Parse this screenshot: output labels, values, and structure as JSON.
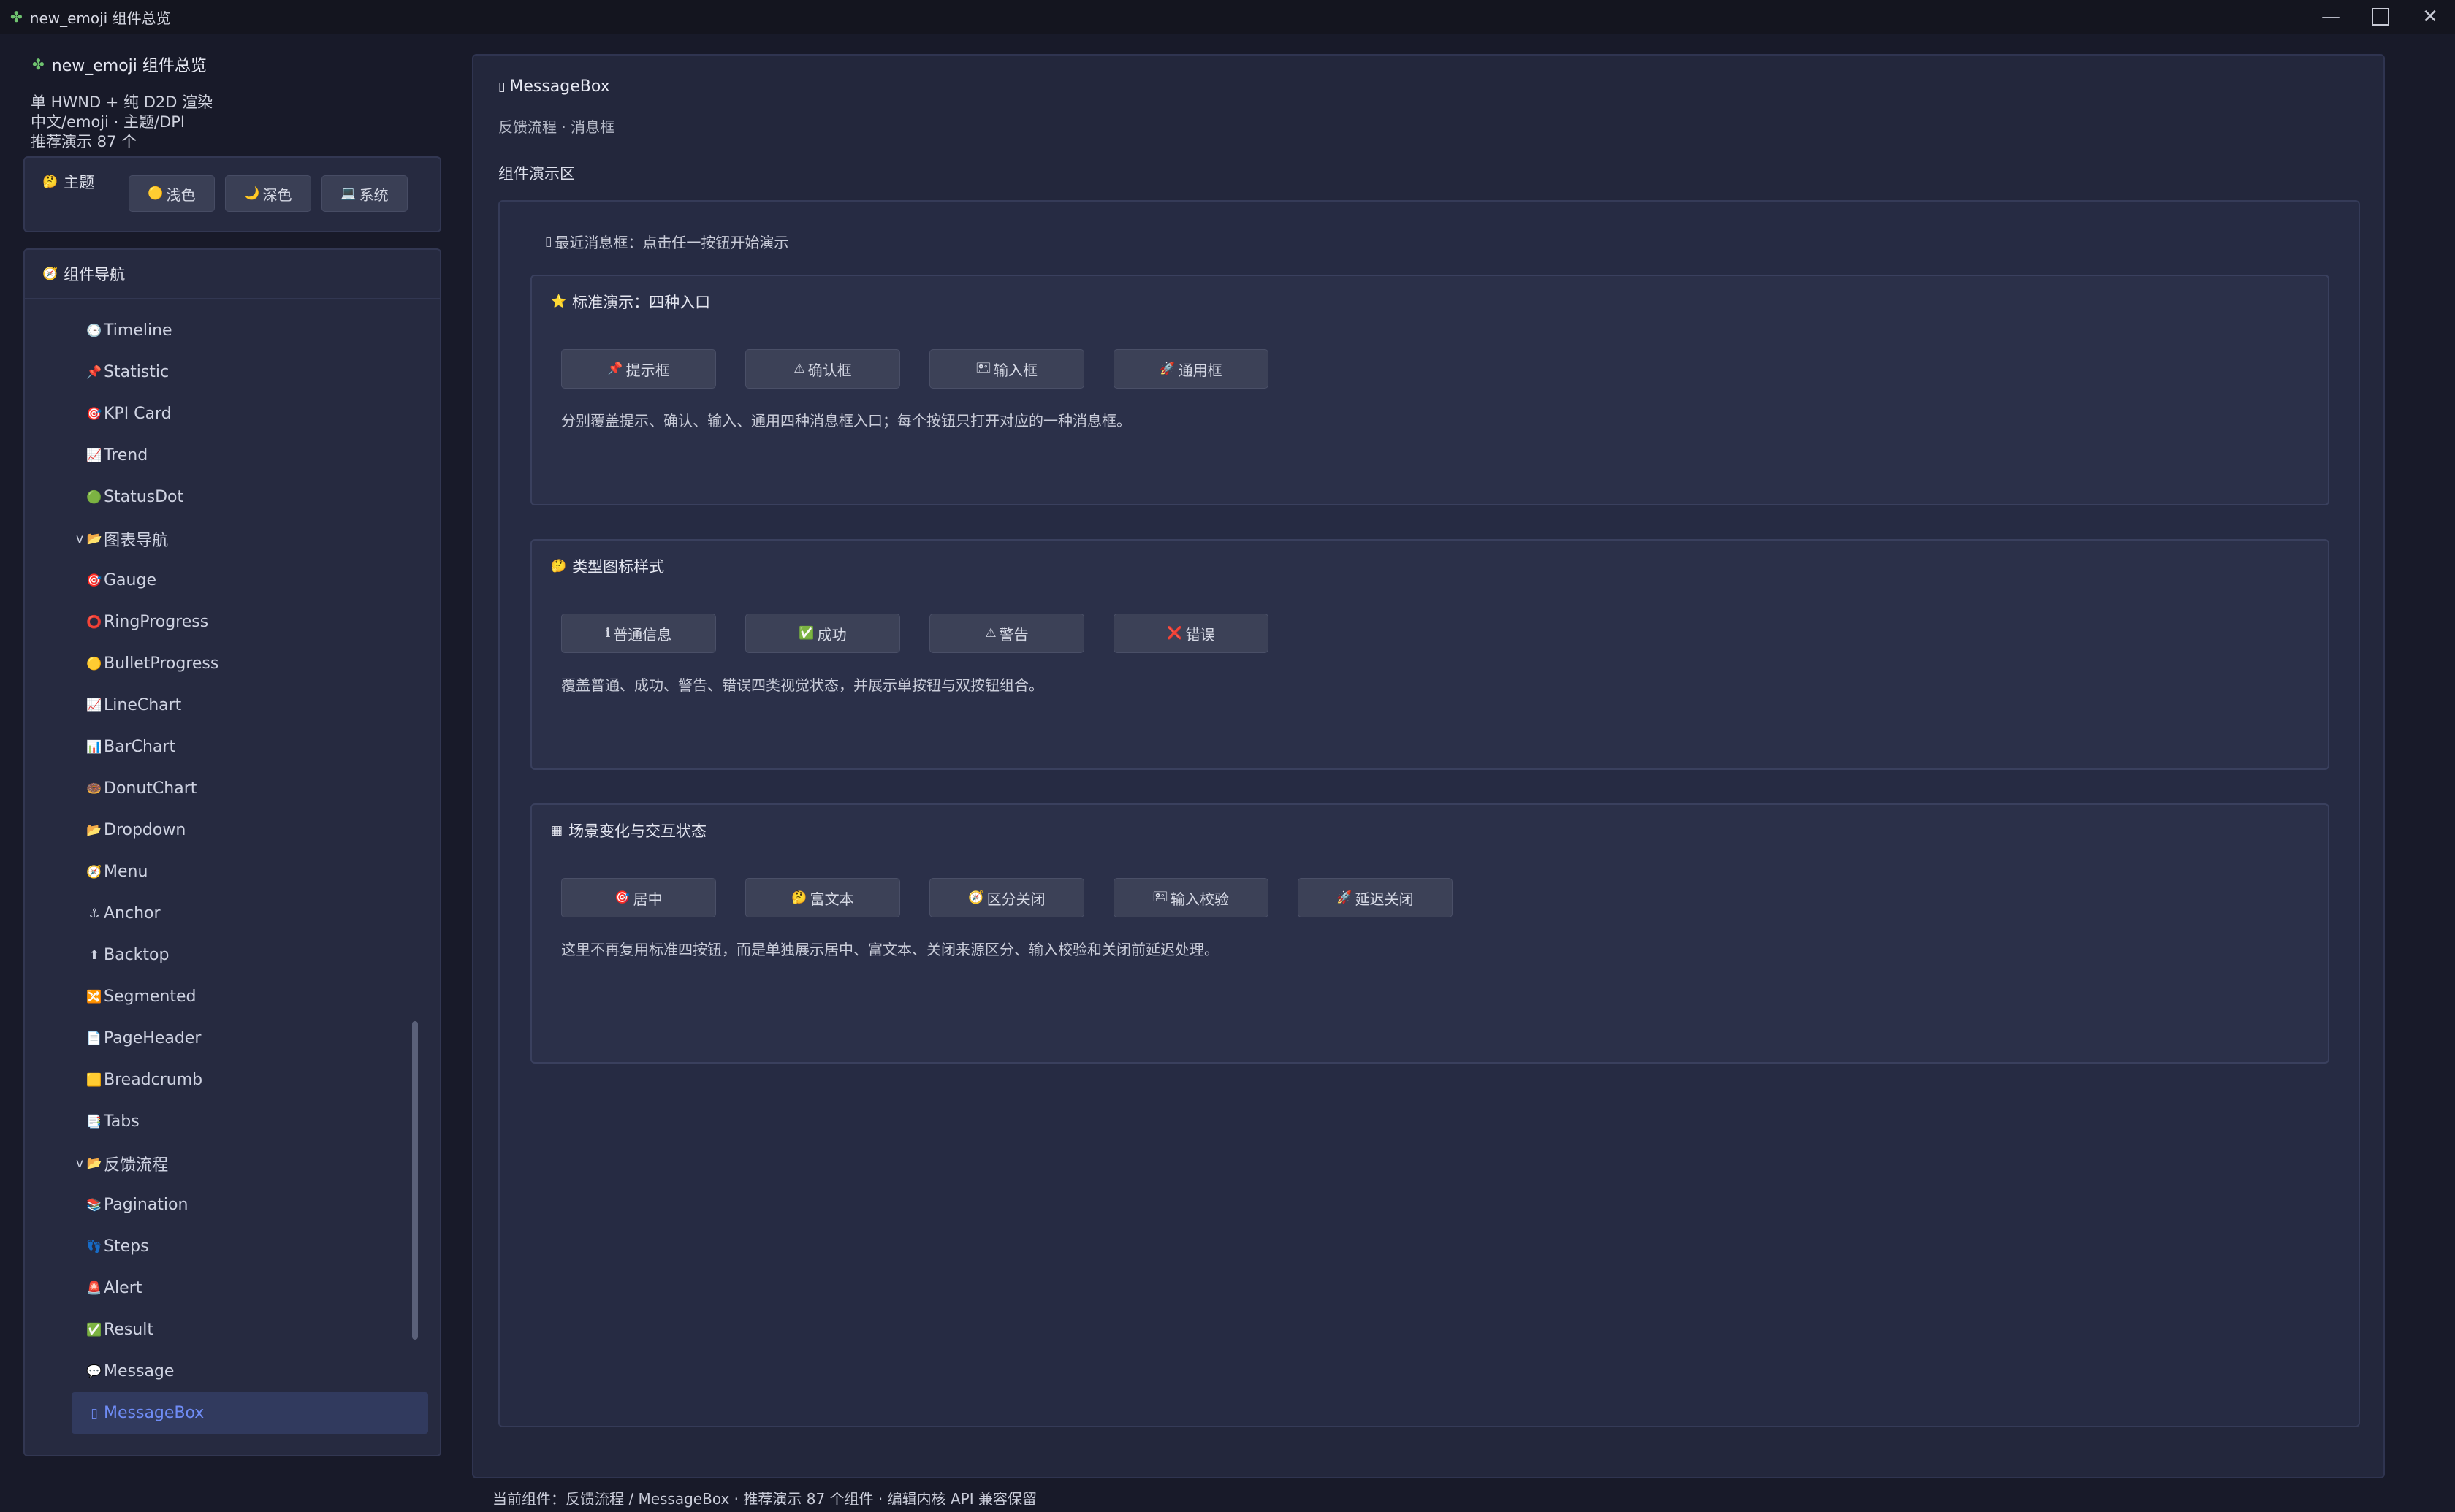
{
  "window": {
    "title": "new_emoji 组件总览",
    "icon": "✤"
  },
  "sidebar": {
    "brand_icon": "✤",
    "brand": "new_emoji 组件总览",
    "info": [
      "单 HWND + 纯 D2D 渲染",
      "中文/emoji · 主题/DPI",
      "推荐演示 87 个"
    ],
    "theme": {
      "icon": "🤔",
      "label": "主题",
      "buttons": [
        {
          "icon": "🟡",
          "label": "浅色"
        },
        {
          "icon": "🌙",
          "label": "深色"
        },
        {
          "icon": "💻",
          "label": "系统"
        }
      ]
    },
    "nav": {
      "icon": "🧭",
      "heading": "组件导航",
      "items": [
        {
          "type": "leaf",
          "icon": "🕒",
          "label": "Timeline"
        },
        {
          "type": "leaf",
          "icon": "📌",
          "label": "Statistic"
        },
        {
          "type": "leaf",
          "icon": "🎯",
          "label": "KPI Card"
        },
        {
          "type": "leaf",
          "icon": "📈",
          "label": "Trend"
        },
        {
          "type": "leaf",
          "icon": "🟢",
          "label": "StatusDot"
        },
        {
          "type": "group",
          "icon": "📂",
          "label": "图表导航",
          "chevron": "v"
        },
        {
          "type": "leaf",
          "icon": "🎯",
          "label": "Gauge"
        },
        {
          "type": "leaf",
          "icon": "⭕",
          "label": "RingProgress"
        },
        {
          "type": "leaf",
          "icon": "🟡",
          "label": "BulletProgress"
        },
        {
          "type": "leaf",
          "icon": "📈",
          "label": "LineChart"
        },
        {
          "type": "leaf",
          "icon": "📊",
          "label": "BarChart"
        },
        {
          "type": "leaf",
          "icon": "🍩",
          "label": "DonutChart"
        },
        {
          "type": "leaf",
          "icon": "📂",
          "label": "Dropdown"
        },
        {
          "type": "leaf",
          "icon": "🧭",
          "label": "Menu"
        },
        {
          "type": "leaf",
          "icon": "⚓",
          "label": "Anchor"
        },
        {
          "type": "leaf",
          "icon": "⬆",
          "label": "Backtop"
        },
        {
          "type": "leaf",
          "icon": "🔀",
          "label": "Segmented"
        },
        {
          "type": "leaf",
          "icon": "📄",
          "label": "PageHeader"
        },
        {
          "type": "leaf",
          "icon": "🟨",
          "label": "Breadcrumb"
        },
        {
          "type": "leaf",
          "icon": "📑",
          "label": "Tabs"
        },
        {
          "type": "group",
          "icon": "📂",
          "label": "反馈流程",
          "chevron": "v"
        },
        {
          "type": "leaf",
          "icon": "📚",
          "label": "Pagination"
        },
        {
          "type": "leaf",
          "icon": "👣",
          "label": "Steps"
        },
        {
          "type": "leaf",
          "icon": "🚨",
          "label": "Alert"
        },
        {
          "type": "leaf",
          "icon": "✅",
          "label": "Result"
        },
        {
          "type": "leaf",
          "icon": "💬",
          "label": "Message"
        },
        {
          "type": "leaf",
          "icon": "▯",
          "label": "MessageBox",
          "active": true
        }
      ]
    }
  },
  "main": {
    "title_icon": "▯",
    "title": "MessageBox",
    "subtitle": "反馈流程 · 消息框",
    "demo_label": "组件演示区",
    "recent_icon": "▯",
    "recent": "最近消息框：点击任一按钮开始演示",
    "sections": [
      {
        "icon": "⭐",
        "title": "标准演示：四种入口",
        "buttons": [
          {
            "icon": "📌",
            "label": "提示框"
          },
          {
            "icon": "⚠",
            "label": "确认框"
          },
          {
            "icon": "🖭",
            "label": "输入框"
          },
          {
            "icon": "🚀",
            "label": "通用框"
          }
        ],
        "desc": "分别覆盖提示、确认、输入、通用四种消息框入口；每个按钮只打开对应的一种消息框。"
      },
      {
        "icon": "🤔",
        "title": "类型图标样式",
        "buttons": [
          {
            "icon": "ℹ",
            "label": "普通信息"
          },
          {
            "icon": "✅",
            "label": "成功"
          },
          {
            "icon": "⚠",
            "label": "警告"
          },
          {
            "icon": "❌",
            "label": "错误"
          }
        ],
        "desc": "覆盖普通、成功、警告、错误四类视觉状态，并展示单按钮与双按钮组合。"
      },
      {
        "icon": "▦",
        "title": "场景变化与交互状态",
        "buttons": [
          {
            "icon": "🎯",
            "label": "居中"
          },
          {
            "icon": "🤔",
            "label": "富文本"
          },
          {
            "icon": "🧭",
            "label": "区分关闭"
          },
          {
            "icon": "🖭",
            "label": "输入校验"
          },
          {
            "icon": "🚀",
            "label": "延迟关闭"
          }
        ],
        "desc": "这里不再复用标准四按钮，而是单独展示居中、富文本、关闭来源区分、输入校验和关闭前延迟处理。"
      }
    ]
  },
  "status_bar": "当前组件：反馈流程 / MessageBox · 推荐演示 87 个组件 · 编辑内核 API 兼容保留",
  "colors": {
    "background": "#181a29",
    "panel": "#262a40",
    "accent": "#6f8cf5",
    "button": "#3c4157"
  }
}
